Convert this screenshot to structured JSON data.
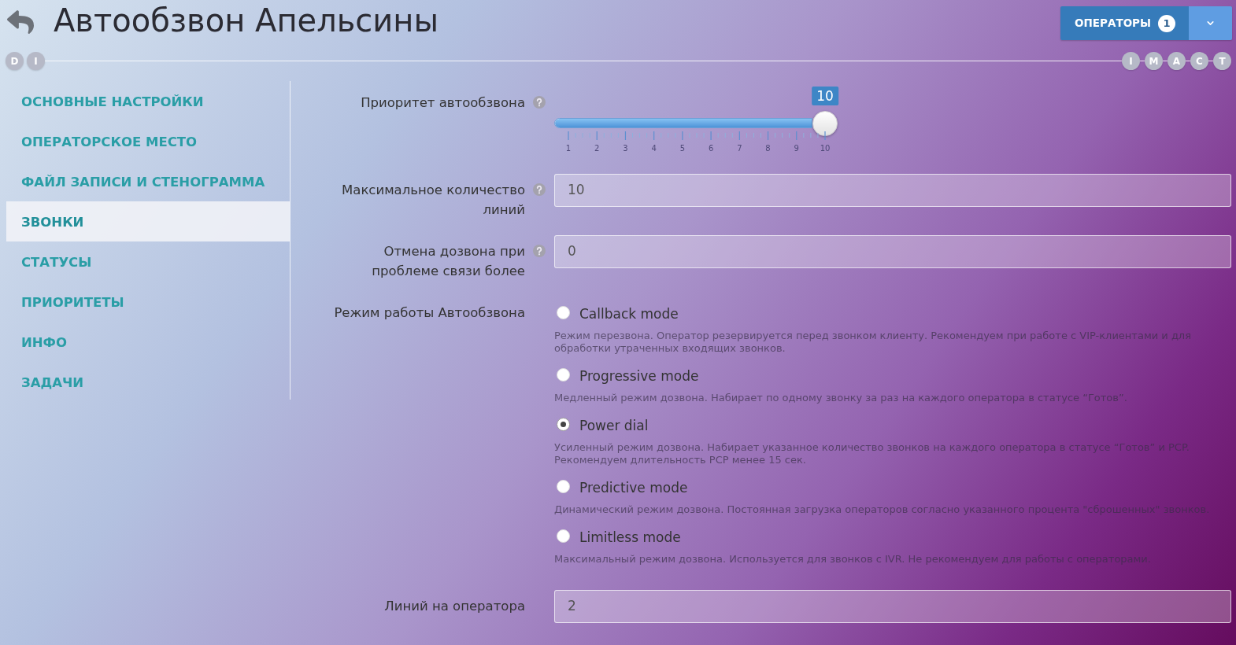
{
  "header": {
    "title": "Автообзвон Апельсины",
    "operators_button": {
      "label": "ОПЕРАТОРЫ",
      "count": "1"
    }
  },
  "step_markers": {
    "left": [
      {
        "label": "D"
      },
      {
        "label": "I"
      }
    ],
    "right": [
      {
        "label": "I"
      },
      {
        "label": "M"
      },
      {
        "label": "A"
      },
      {
        "label": "C"
      },
      {
        "label": "T"
      }
    ]
  },
  "sidebar": {
    "items": [
      {
        "label": "ОСНОВНЫЕ НАСТРОЙКИ",
        "selected": false
      },
      {
        "label": "ОПЕРАТОРСКОЕ МЕСТО",
        "selected": false
      },
      {
        "label": "ФАЙЛ ЗАПИСИ И СТЕНОГРАММА",
        "selected": false
      },
      {
        "label": "ЗВОНКИ",
        "selected": true
      },
      {
        "label": "СТАТУСЫ",
        "selected": false
      },
      {
        "label": "ПРИОРИТЕТЫ",
        "selected": false
      },
      {
        "label": "ИНФО",
        "selected": false
      },
      {
        "label": "ЗАДАЧИ",
        "selected": false
      }
    ]
  },
  "form": {
    "fields": [
      {
        "kind": "slider",
        "label": "Приоритет автообзвона",
        "help": true,
        "value": "10",
        "level": 1,
        "scale_labels": [
          "1",
          "2",
          "3",
          "4",
          "5",
          "6",
          "7",
          "8",
          "9",
          "10"
        ]
      },
      {
        "kind": "input",
        "label": "Максимальное количество линий",
        "help": true,
        "value": "10"
      },
      {
        "kind": "input",
        "label": "Отмена дозвона при проблеме связи более",
        "help": true,
        "value": "0"
      },
      {
        "kind": "radio",
        "label": "Режим работы Автообзвона",
        "help": false,
        "options": [
          {
            "label": "Callback mode",
            "selected": false,
            "description": "Режим перезвона. Оператор резервируется перед звонком клиенту. Рекомендуем при работе с VIP-клиентами и для обработки утраченных входящих звонков."
          },
          {
            "label": "Progressive mode",
            "selected": false,
            "description": "Медленный режим дозвона. Набирает по одному звонку за раз на каждого оператора в статусе “Готов”."
          },
          {
            "label": "Power dial",
            "selected": true,
            "description": "Усиленный режим дозвона. Набирает указанное количество звонков на каждого оператора в статусе “Готов” и PCP. Рекомендуем длительность PCP менее 15 сек."
          },
          {
            "label": "Predictive mode",
            "selected": false,
            "description": "Динамический режим дозвона. Постоянная загрузка операторов согласно указанного процента \"сброшенных\" звонков."
          },
          {
            "label": "Limitless mode",
            "selected": false,
            "description": "Максимальный режим дозвона. Используется для звонков с IVR. Не рекомендуем для работы с операторами."
          }
        ]
      },
      {
        "kind": "input",
        "label": "Линий на оператора",
        "help": false,
        "value": "2"
      }
    ]
  }
}
